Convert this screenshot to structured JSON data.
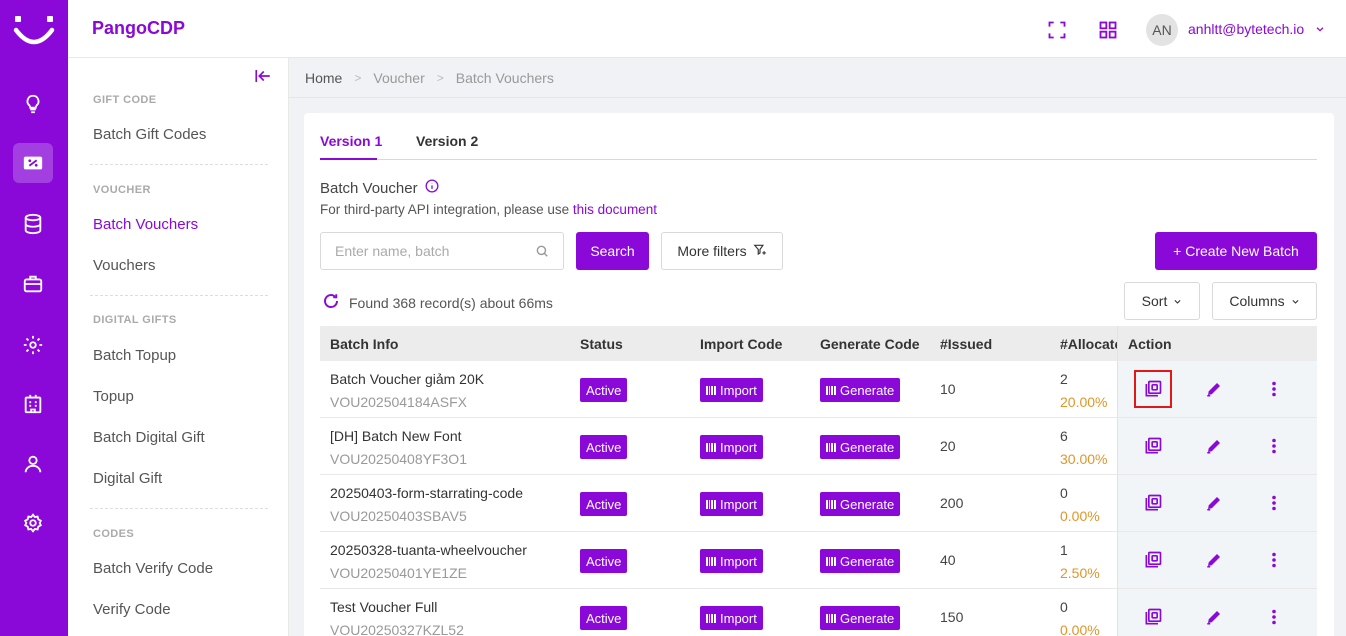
{
  "app": {
    "brand": "PangoCDP"
  },
  "rail": {
    "icons": [
      "lightbulb-icon",
      "voucher-icon",
      "database-icon",
      "briefcase-icon",
      "settings-gear-icon",
      "building-icon",
      "user-icon",
      "settings-icon"
    ],
    "active_index": 1
  },
  "topbar": {
    "avatar_initials": "AN",
    "user_email": "anhltt@bytetech.io"
  },
  "sidebar": {
    "sections": [
      {
        "title": "GIFT CODE",
        "items": [
          "Batch Gift Codes"
        ]
      },
      {
        "title": "VOUCHER",
        "items": [
          "Batch Vouchers",
          "Vouchers"
        ]
      },
      {
        "title": "DIGITAL GIFTS",
        "items": [
          "Batch Topup",
          "Topup",
          "Batch Digital Gift",
          "Digital Gift"
        ]
      },
      {
        "title": "CODES",
        "items": [
          "Batch Verify Code",
          "Verify Code"
        ]
      }
    ],
    "active_item": "Batch Vouchers"
  },
  "breadcrumb": {
    "home": "Home",
    "voucher": "Voucher",
    "current": "Batch Vouchers"
  },
  "tabs": {
    "v1": "Version 1",
    "v2": "Version 2"
  },
  "section": {
    "title": "Batch Voucher",
    "desc_prefix": "For third-party API integration, please use",
    "desc_link": "this document"
  },
  "search": {
    "placeholder": "Enter name, batch",
    "button": "Search"
  },
  "filters": {
    "more": "More filters",
    "create": "+ Create New Batch",
    "sort": "Sort",
    "columns": "Columns"
  },
  "status": {
    "found": "Found 368 record(s) about 66ms"
  },
  "table": {
    "headers": [
      "Batch Info",
      "Status",
      "Import Code",
      "Generate Code",
      "#Issued",
      "#Allocate",
      "Action"
    ],
    "rows": [
      {
        "name": "Batch Voucher giảm 20K",
        "code": "VOU202504184ASFX",
        "status": "Active",
        "import": "Import",
        "generate": "Generate",
        "issued": "10",
        "allocated": "2",
        "percent": "20.00%"
      },
      {
        "name": "[DH] Batch New Font",
        "code": "VOU20250408YF3O1",
        "status": "Active",
        "import": "Import",
        "generate": "Generate",
        "issued": "20",
        "allocated": "6",
        "percent": "30.00%"
      },
      {
        "name": "20250403-form-starrating-code",
        "code": "VOU20250403SBAV5",
        "status": "Active",
        "import": "Import",
        "generate": "Generate",
        "issued": "200",
        "allocated": "0",
        "percent": "0.00%"
      },
      {
        "name": "20250328-tuanta-wheelvoucher",
        "code": "VOU20250401YE1ZE",
        "status": "Active",
        "import": "Import",
        "generate": "Generate",
        "issued": "40",
        "allocated": "1",
        "percent": "2.50%"
      },
      {
        "name": "Test Voucher Full",
        "code": "VOU20250327KZL52",
        "status": "Active",
        "import": "Import",
        "generate": "Generate",
        "issued": "150",
        "allocated": "0",
        "percent": "0.00%"
      }
    ]
  },
  "colors": {
    "accent": "#8a08d8",
    "percent": "#e0962a",
    "highlight": "#e01818"
  }
}
